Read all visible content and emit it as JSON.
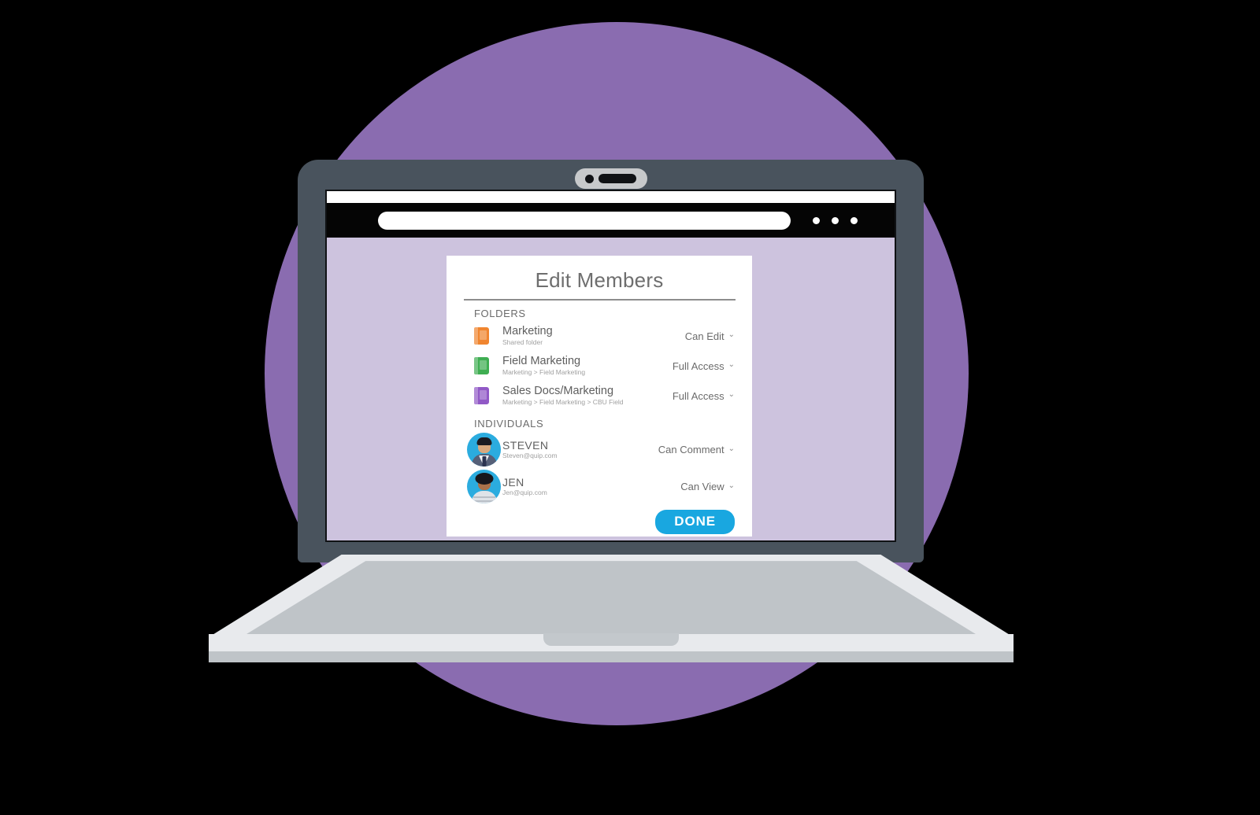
{
  "scene": {
    "background_color": "#000000",
    "circle_color": "#8a6cb0",
    "laptop_lid_color": "#49535d",
    "laptop_base_color": "#e8eaed",
    "screen_background": "#cdc3de"
  },
  "browser": {
    "chrome_color": "#050505",
    "url_bar_value": "",
    "url_bar_placeholder": "",
    "menu_dots": [
      "dot",
      "dot",
      "dot"
    ]
  },
  "dialog": {
    "title": "Edit Members",
    "sections": [
      {
        "label": "FOLDERS",
        "type": "folders",
        "rows": [
          {
            "icon": "folder-icon",
            "icon_color": "#f0852f",
            "title": "Marketing",
            "subtitle": "Shared folder",
            "permission": "Can Edit",
            "chevron": "⌄"
          },
          {
            "icon": "folder-icon",
            "icon_color": "#3fae52",
            "title": "Field Marketing",
            "subtitle": "Marketing > Field Marketing",
            "permission": "Full Access",
            "chevron": "⌄"
          },
          {
            "icon": "folder-icon",
            "icon_color": "#9159c6",
            "title": "Sales Docs/Marketing",
            "subtitle": "Marketing > Field Marketing > CBU Field",
            "permission": "Full Access",
            "chevron": "⌄"
          }
        ]
      },
      {
        "label": "INDIVIDUALS",
        "type": "individuals",
        "rows": [
          {
            "icon": "avatar",
            "avatar_bg": "#2bacdf",
            "title": "STEVEN",
            "subtitle": "Steven@quip.com",
            "permission": "Can Comment",
            "chevron": "⌄"
          },
          {
            "icon": "avatar",
            "avatar_bg": "#2bacdf",
            "title": "JEN",
            "subtitle": "Jen@quip.com",
            "permission": "Can View",
            "chevron": "⌄"
          }
        ]
      }
    ],
    "done_label": "DONE",
    "done_color": "#19a7e0"
  }
}
